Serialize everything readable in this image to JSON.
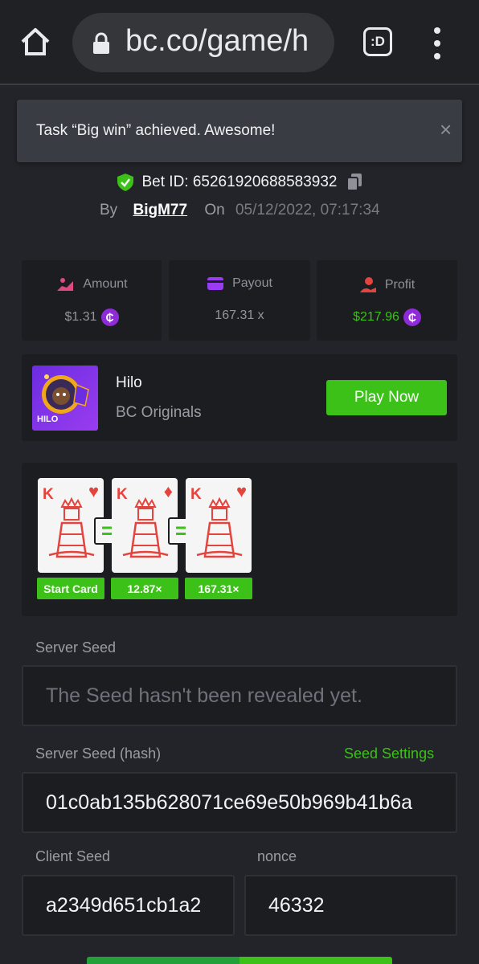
{
  "browser": {
    "url": "bc.co/game/h",
    "tab_label": ":D"
  },
  "toast": {
    "message": "Task “Big win” achieved. Awesome!",
    "close": "×"
  },
  "bet": {
    "id_label": "Bet ID: 65261920688583932",
    "by_label": "By",
    "user": "BigM77",
    "on_label": "On",
    "date": "05/12/2022, 07:17:34"
  },
  "stats": {
    "amount": {
      "label": "Amount",
      "value": "$1.31",
      "icon_color": "#e0497d"
    },
    "payout": {
      "label": "Payout",
      "value": "167.31 x",
      "icon_color": "#9b3cf5"
    },
    "profit": {
      "label": "Profit",
      "value": "$217.96",
      "icon_color": "#e3443d"
    },
    "coin_symbol": "₵"
  },
  "game": {
    "name": "Hilo",
    "provider": "BC Originals",
    "thumb_label": "HILO",
    "play_label": "Play Now"
  },
  "cards": {
    "items": [
      {
        "rank": "K",
        "suit": "♥",
        "multiplier": "Start Card"
      },
      {
        "rank": "K",
        "suit": "♦",
        "multiplier": "12.87×"
      },
      {
        "rank": "K",
        "suit": "♥",
        "multiplier": "167.31×"
      }
    ],
    "equals": "="
  },
  "seeds": {
    "server_seed_label": "Server Seed",
    "server_seed_placeholder": "The Seed hasn't been revealed yet.",
    "server_hash_label": "Server Seed (hash)",
    "seed_settings_label": "Seed Settings",
    "server_hash_value": "01c0ab135b628071ce69e50b969b41b6a",
    "client_seed_label": "Client Seed",
    "client_seed_value": "a2349d651cb1a2",
    "nonce_label": "nonce",
    "nonce_value": "46332"
  },
  "colors": {
    "accent_green": "#3bc117",
    "background": "#232429",
    "panel": "#1c1d21"
  }
}
